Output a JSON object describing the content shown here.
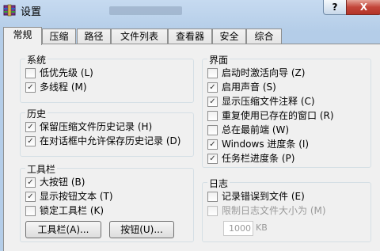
{
  "window": {
    "title": "设置",
    "help": "?",
    "close": "X"
  },
  "tabs": [
    "常规",
    "压缩",
    "路径",
    "文件列表",
    "查看器",
    "安全",
    "综合"
  ],
  "groups": {
    "system": {
      "title": "系统",
      "items": [
        {
          "label": "低优先级 (L)",
          "checked": false
        },
        {
          "label": "多线程 (M)",
          "checked": true
        }
      ]
    },
    "history": {
      "title": "历史",
      "items": [
        {
          "label": "保留压缩文件历史记录 (H)",
          "checked": true
        },
        {
          "label": "在对话框中允许保存历史记录 (D)",
          "checked": true
        }
      ]
    },
    "toolbar": {
      "title": "工具栏",
      "items": [
        {
          "label": "大按钮 (B)",
          "checked": true
        },
        {
          "label": "显示按钮文本 (T)",
          "checked": true
        },
        {
          "label": "锁定工具栏 (K)",
          "checked": false
        }
      ],
      "buttons": [
        "工具栏(A)...",
        "按钮(U)..."
      ]
    },
    "interface": {
      "title": "界面",
      "items": [
        {
          "label": "启动时激活向导 (Z)",
          "checked": false
        },
        {
          "label": "启用声音 (S)",
          "checked": true
        },
        {
          "label": "显示压缩文件注释 (C)",
          "checked": true
        },
        {
          "label": "重复使用已存在的窗口 (R)",
          "checked": false
        },
        {
          "label": "总在最前端 (W)",
          "checked": false
        },
        {
          "label": "Windows 进度条 (I)",
          "checked": true
        },
        {
          "label": "任务栏进度条 (P)",
          "checked": true
        }
      ]
    },
    "log": {
      "title": "日志",
      "items": [
        {
          "label": "记录错误到文件 (E)",
          "checked": false
        },
        {
          "label": "限制日志文件大小为 (M)",
          "checked": false,
          "disabled": true
        }
      ],
      "size_value": "1000",
      "size_unit": "KB"
    }
  },
  "check_glyph": "✓"
}
